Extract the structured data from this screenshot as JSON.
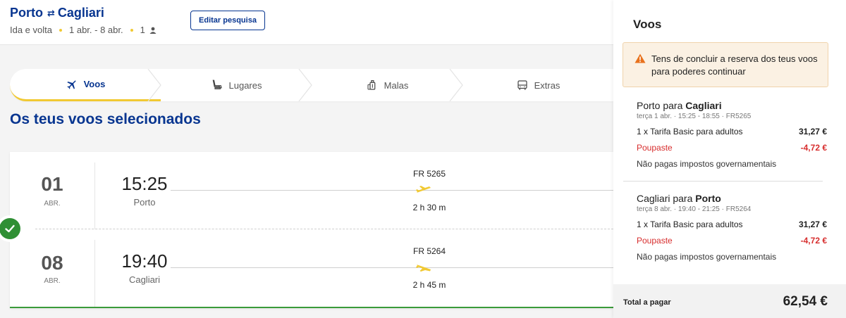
{
  "header": {
    "origin": "Porto",
    "destination": "Cagliari",
    "trip_type": "Ida e volta",
    "dates": "1 abr. - 8 abr.",
    "passengers": "1",
    "edit_label": "Editar pesquisa"
  },
  "steps": [
    {
      "label": "Voos",
      "icon": "plane-icon",
      "active": true
    },
    {
      "label": "Lugares",
      "icon": "seat-icon",
      "active": false
    },
    {
      "label": "Malas",
      "icon": "bag-icon",
      "active": false
    },
    {
      "label": "Extras",
      "icon": "bus-icon",
      "active": false
    }
  ],
  "main": {
    "title": "Os teus voos selecionados",
    "flights": [
      {
        "day": "01",
        "month": "ABR.",
        "time": "15:25",
        "city": "Porto",
        "flight_no": "FR 5265",
        "duration": "2 h 30 m"
      },
      {
        "day": "08",
        "month": "ABR.",
        "time": "19:40",
        "city": "Cagliari",
        "flight_no": "FR 5264",
        "duration": "2 h 45 m"
      }
    ]
  },
  "sidebar": {
    "title": "Voos",
    "warning": "Tens de concluir a reserva dos teus voos para poderes continuar",
    "segments": [
      {
        "from": "Porto para ",
        "to": "Cagliari",
        "details": "terça 1 abr. · 15:25 - 18:55 · FR5265",
        "fare_label": "1 x Tarifa Basic para adultos",
        "fare_value": "31,27 €",
        "saving_label": "Poupaste",
        "saving_value": "-4,72 €",
        "tax_note": "Não pagas impostos governamentais"
      },
      {
        "from": "Cagliari para ",
        "to": "Porto",
        "details": "terça 8 abr. · 19:40 - 21:25 · FR5264",
        "fare_label": "1 x Tarifa Basic para adultos",
        "fare_value": "31,27 €",
        "saving_label": "Poupaste",
        "saving_value": "-4,72 €",
        "tax_note": "Não pagas impostos governamentais"
      }
    ],
    "total_label": "Total a pagar",
    "total_value": "62,54 €"
  },
  "colors": {
    "brand_blue": "#073590",
    "accent_yellow": "#f1c933",
    "success_green": "#2f8f34",
    "saving_red": "#d72d2d",
    "warning_orange": "#e8711c"
  }
}
